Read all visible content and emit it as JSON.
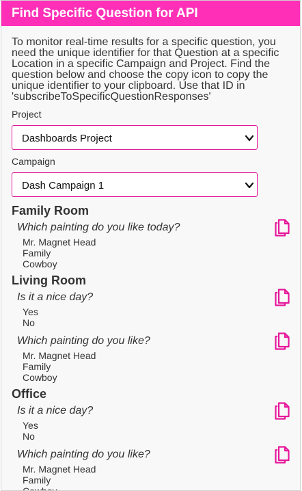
{
  "header": {
    "title": "Find Specific Question for API"
  },
  "intro": "To monitor real-time results for a specific question, you need the unique identifier for that Question at a specific Location in a specific Campaign and Project. Find the question below and choose the copy icon to copy the unique identifier to your clipboard. Use that ID in 'subscribeToSpecificQuestionResponses'",
  "project": {
    "label": "Project",
    "selected": "Dashboards Project"
  },
  "campaign": {
    "label": "Campaign",
    "selected": "Dash Campaign 1"
  },
  "colors": {
    "accent": "#ff2fb8",
    "border": "#e0189a",
    "icon": "#e6179b"
  },
  "locations": [
    {
      "name": "Family Room",
      "questions": [
        {
          "text": "Which painting do you like today?",
          "options": [
            "Mr. Magnet Head",
            "Family",
            "Cowboy"
          ],
          "icon": "copy-icon"
        }
      ]
    },
    {
      "name": "Living Room",
      "questions": [
        {
          "text": "Is it a nice day?",
          "options": [
            "Yes",
            "No"
          ],
          "icon": "copy-icon"
        },
        {
          "text": "Which painting do you like?",
          "options": [
            "Mr. Magnet Head",
            "Family",
            "Cowboy"
          ],
          "icon": "copy-icon"
        }
      ]
    },
    {
      "name": "Office",
      "questions": [
        {
          "text": "Is it a nice day?",
          "options": [
            "Yes",
            "No"
          ],
          "icon": "copy-icon"
        },
        {
          "text": "Which painting do you like?",
          "options": [
            "Mr. Magnet Head",
            "Family",
            "Cowboy"
          ],
          "icon": "copy-icon"
        }
      ]
    }
  ]
}
